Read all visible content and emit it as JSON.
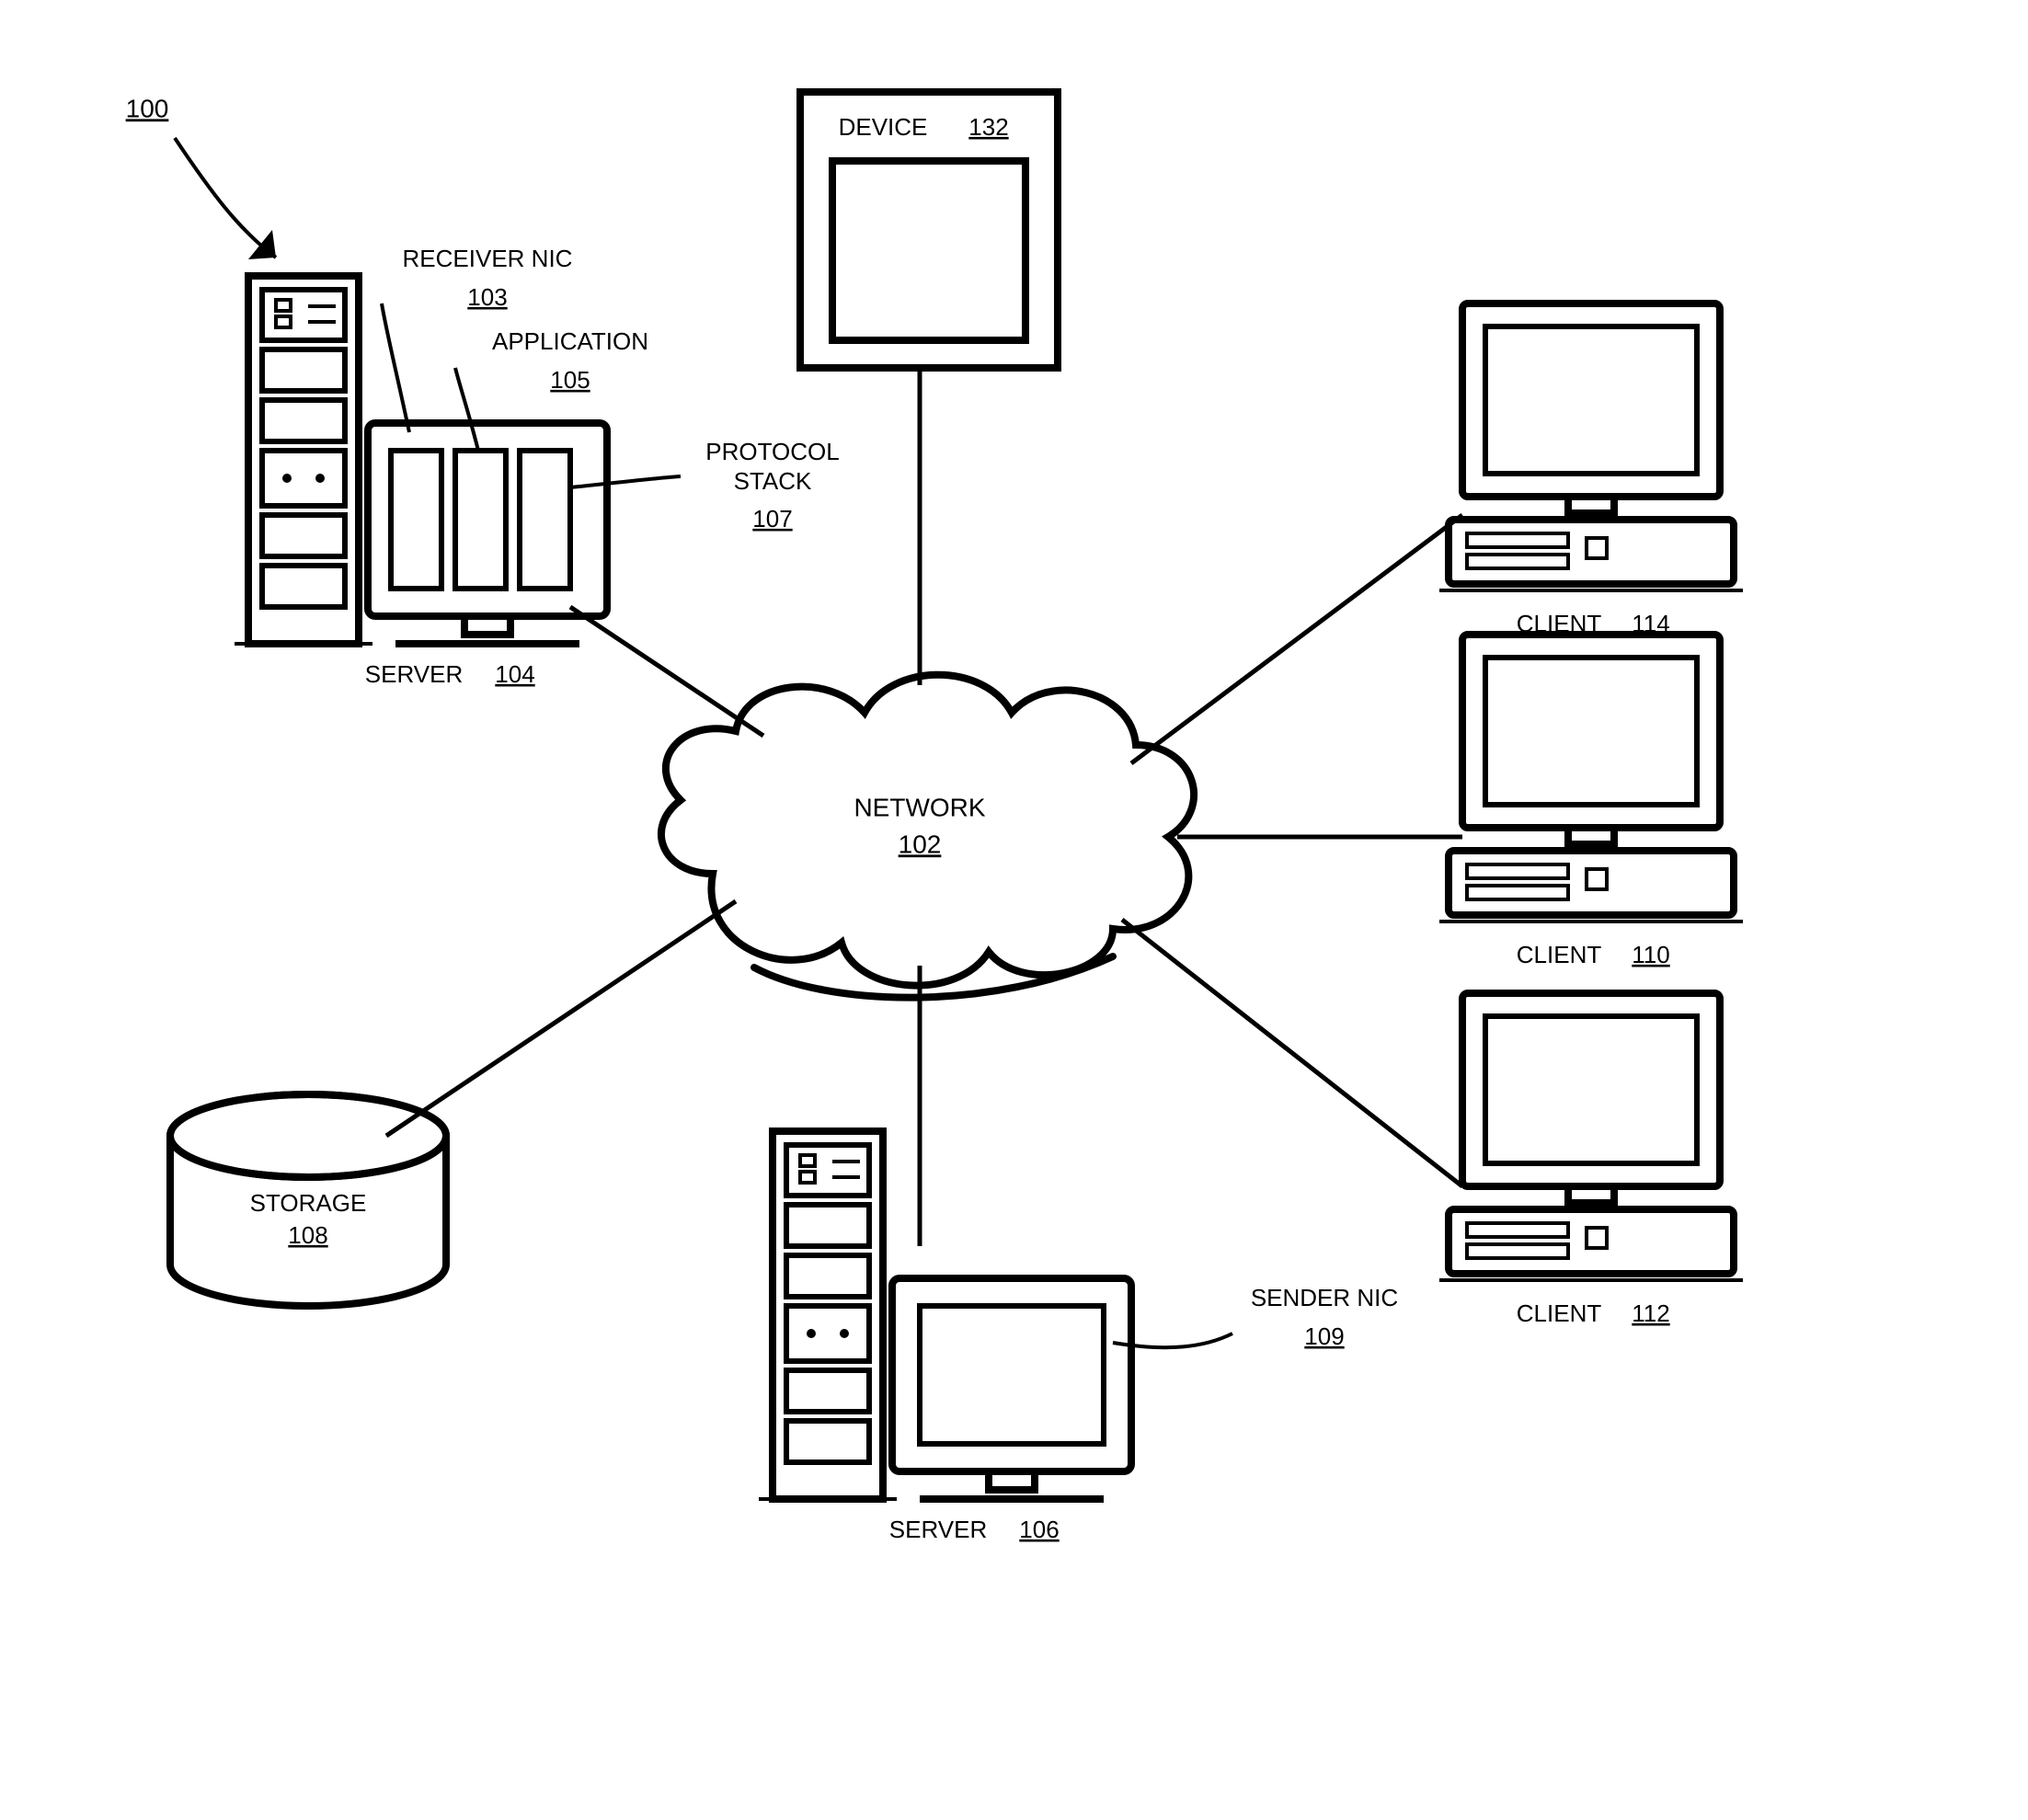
{
  "figure_ref": "100",
  "network": {
    "label": "NETWORK",
    "ref": "102"
  },
  "device": {
    "label": "DEVICE",
    "ref": "132"
  },
  "server1": {
    "label": "SERVER",
    "ref": "104"
  },
  "server2": {
    "label": "SERVER",
    "ref": "106"
  },
  "storage": {
    "label": "STORAGE",
    "ref": "108"
  },
  "client1": {
    "label": "CLIENT",
    "ref": "114"
  },
  "client2": {
    "label": "CLIENT",
    "ref": "110"
  },
  "client3": {
    "label": "CLIENT",
    "ref": "112"
  },
  "receiver_nic": {
    "label": "RECEIVER NIC",
    "ref": "103"
  },
  "application": {
    "label": "APPLICATION",
    "ref": "105"
  },
  "protocol_stack": {
    "label": "PROTOCOL",
    "label2": "STACK",
    "ref": "107"
  },
  "sender_nic": {
    "label": "SENDER NIC",
    "ref": "109"
  }
}
